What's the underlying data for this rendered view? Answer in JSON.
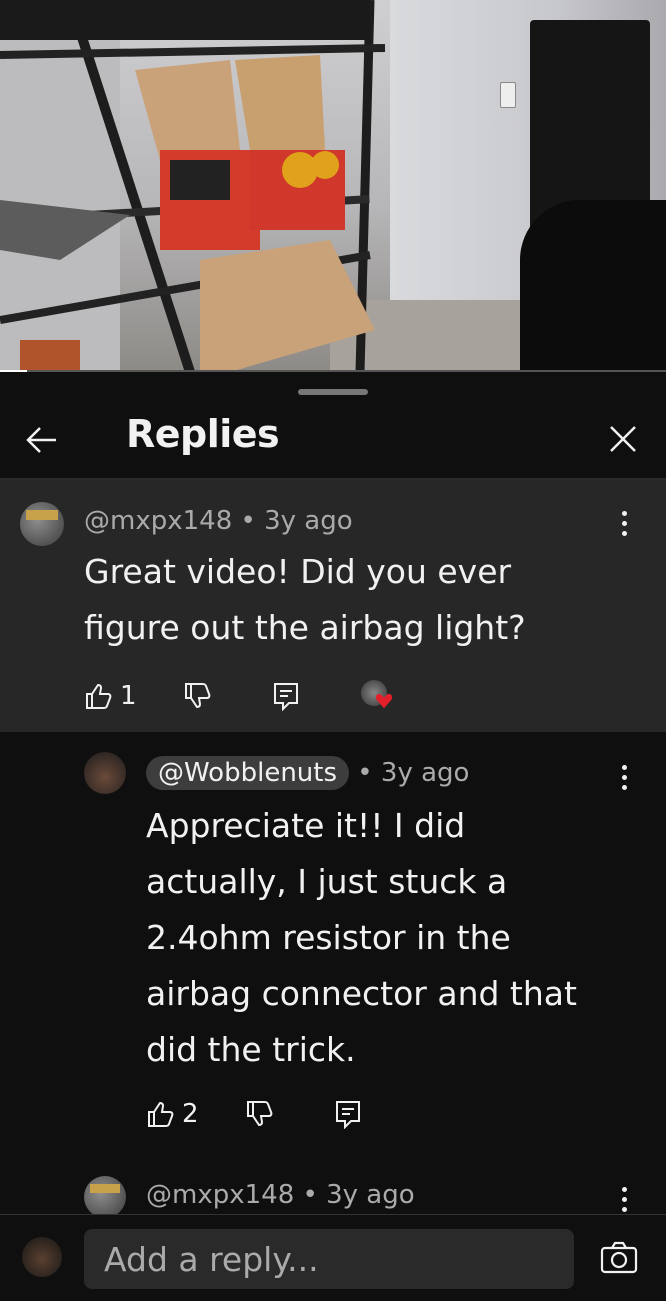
{
  "header": {
    "title": "Replies"
  },
  "parent_comment": {
    "author": "@mxpx148",
    "age": "3y ago",
    "text_line1": "Great video! Did you ever",
    "text_line2": "figure out the airbag light?",
    "like_count": "1"
  },
  "reply": {
    "author": "@Wobblenuts",
    "age": "3y ago",
    "lines": [
      "Appreciate it!! I did",
      "actually, I just stuck a",
      "2.4ohm resistor in the",
      "airbag connector and that",
      "did the trick."
    ],
    "like_count": "2"
  },
  "next_reply": {
    "author": "@mxpx148",
    "age": "3y ago"
  },
  "separator": "•",
  "input": {
    "placeholder": "Add a reply..."
  },
  "colors": {
    "background": "#0f0f0f",
    "parent_bg": "#272727",
    "heart": "#e0202a"
  },
  "video": {
    "progress": 0.04
  }
}
